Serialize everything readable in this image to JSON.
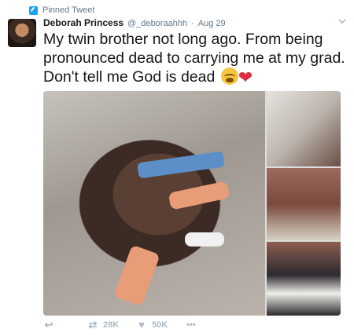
{
  "pinned": {
    "label": "Pinned Tweet",
    "icon": "pin-icon"
  },
  "author": {
    "display_name": "Deborah Princess",
    "handle": "@_deboraahhh",
    "separator": "·",
    "timestamp": "Aug 29"
  },
  "tweet": {
    "text": "My twin brother not long ago. From being pronounced dead to carrying me  at my grad. Don't tell me God is dead",
    "emojis": [
      "crying-face-emoji",
      "red-heart-emoji"
    ]
  },
  "actions": {
    "retweets": "28K",
    "likes": "50K",
    "more_label": "•••"
  },
  "colors": {
    "accent": "#1da1f2",
    "text": "#14171a",
    "muted": "#657786",
    "action": "#aab8c2",
    "heart": "#dd2e44"
  }
}
